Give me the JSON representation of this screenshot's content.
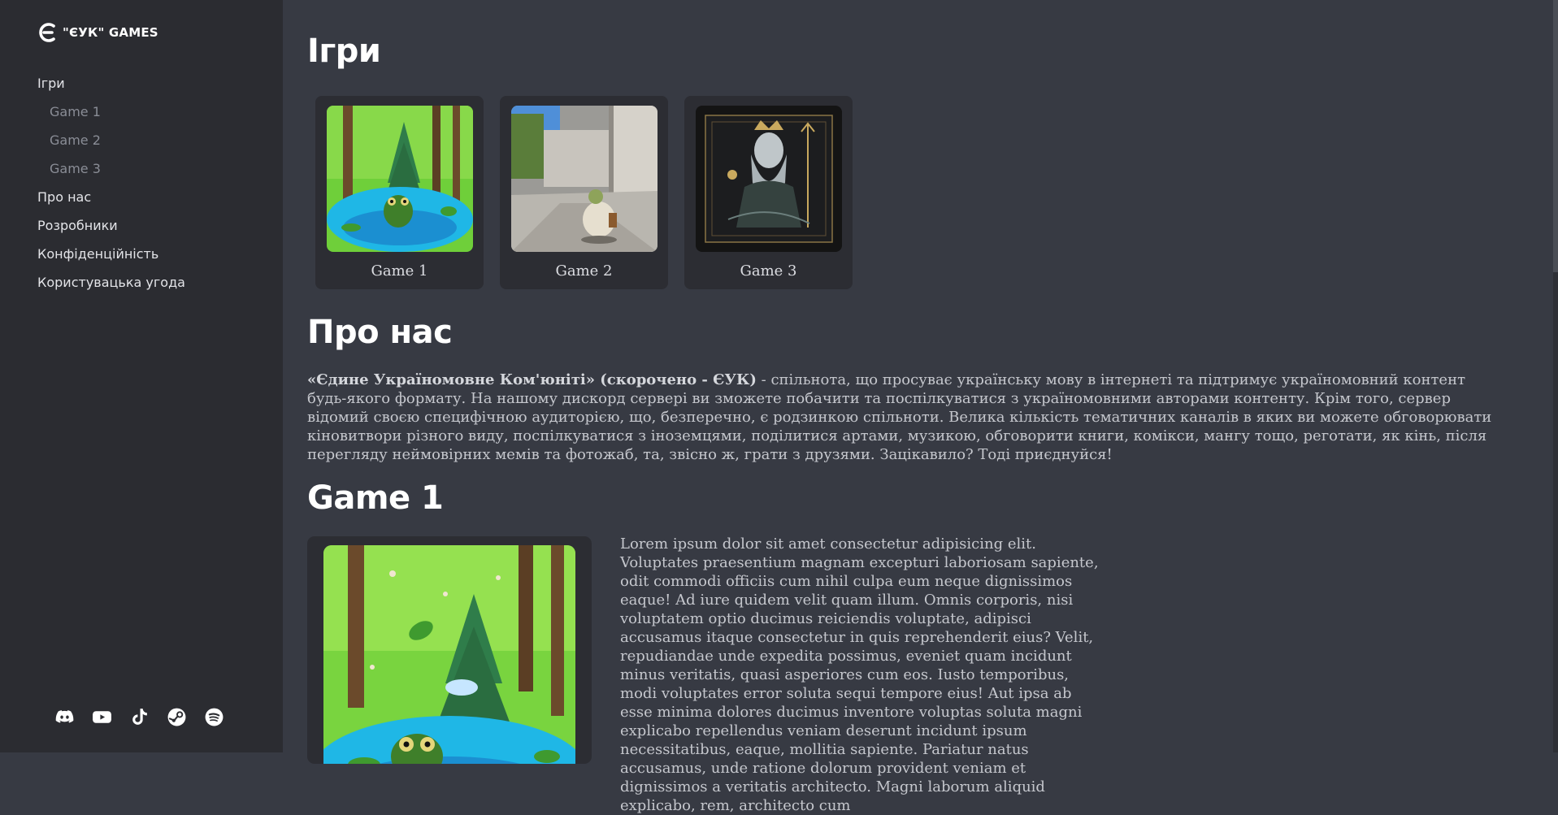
{
  "brand": {
    "name": "\"ЄУК\" GAMES",
    "logo": "euk-logo-icon"
  },
  "nav": {
    "items": [
      {
        "label": "Ігри",
        "sub": false
      },
      {
        "label": "Game 1",
        "sub": true
      },
      {
        "label": "Game 2",
        "sub": true
      },
      {
        "label": "Game 3",
        "sub": true
      },
      {
        "label": "Про нас",
        "sub": false
      },
      {
        "label": "Розробники",
        "sub": false
      },
      {
        "label": "Конфіденційність",
        "sub": false
      },
      {
        "label": "Користувацька угода",
        "sub": false
      }
    ]
  },
  "socials": [
    "discord-icon",
    "youtube-icon",
    "tiktok-icon",
    "steam-icon",
    "spotify-icon"
  ],
  "games_section": {
    "title": "Ігри",
    "cards": [
      {
        "label": "Game 1",
        "image": "frog-in-forest-stream"
      },
      {
        "label": "Game 2",
        "image": "character-in-street"
      },
      {
        "label": "Game 3",
        "image": "sea-king-with-trident"
      }
    ]
  },
  "about": {
    "title": "Про нас",
    "bold_lead": "«Єдине Україномовне Ком'юніті» (скорочено - ЄУК)",
    "text": " - спільнота, що просуває українську мову в інтернеті та підтримує україномовний контент будь-якого формату. На нашому дискорд сервері ви зможете побачити та поспілкуватися з україномовними авторами контенту. Крім того, сервер відомий своєю специфічною аудиторією, що, безперечно, є родзинкою спільноти. Велика кількість тематичних каналів в яких ви можете обговорювати кіновитвори різного виду, поспілкуватися з іноземцями, поділитися артами, музикою, обговорити книги, комікси, мангу тощо, реготати, як кінь, після перегляду неймовірних мемів та фотожаб, та, звісно ж, грати з друзями. Зацікавило? Тоді приєднуйся!"
  },
  "game1": {
    "title": "Game 1",
    "image": "frog-in-forest-stream",
    "text": "Lorem ipsum dolor sit amet consectetur adipisicing elit. Voluptates praesentium magnam excepturi laboriosam sapiente, odit commodi officiis cum nihil culpa eum neque dignissimos eaque! Ad iure quidem velit quam illum. Omnis corporis, nisi voluptatem optio ducimus reiciendis voluptate, adipisci accusamus itaque consectetur in quis reprehenderit eius? Velit, repudiandae unde expedita possimus, eveniet quam incidunt minus veritatis, quasi asperiores cum eos. Iusto temporibus, modi voluptates error soluta sequi tempore eius! Aut ipsa ab esse minima dolores ducimus inventore voluptas soluta magni explicabo repellendus veniam deserunt incidunt ipsum necessitatibus, eaque, mollitia sapiente. Pariatur natus accusamus, unde ratione dolorum provident veniam et dignissimos a veritatis architecto. Magni laborum aliquid explicabo, rem, architecto cum"
  }
}
